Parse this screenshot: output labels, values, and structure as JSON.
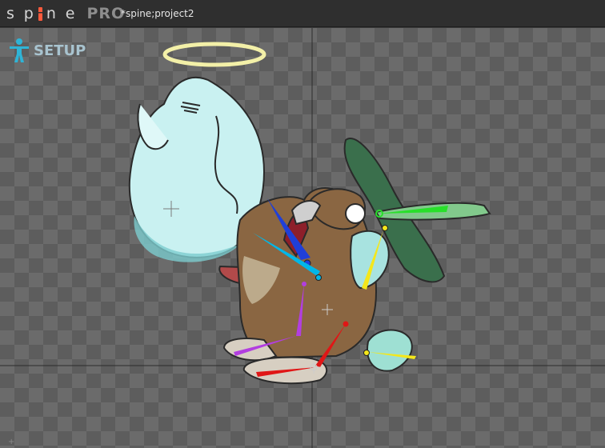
{
  "app": {
    "logo_text": "spine",
    "edition": "PRO",
    "project_title": "*spine;project2"
  },
  "viewport": {
    "mode_label": "SETUP",
    "mode_icon": "skeleton-figure-icon",
    "axis_color": "#2c2c2c",
    "checker_light": "#6b6b6b",
    "checker_dark": "#5d5d5d"
  },
  "bone_colors": {
    "head": "#00b7e8",
    "head_alt": "#1f3fd8",
    "ear_green": "#28e02a",
    "ear_yellow": "#f4e71b",
    "leg_front": "#b23ee0",
    "leg_back": "#e01616"
  }
}
